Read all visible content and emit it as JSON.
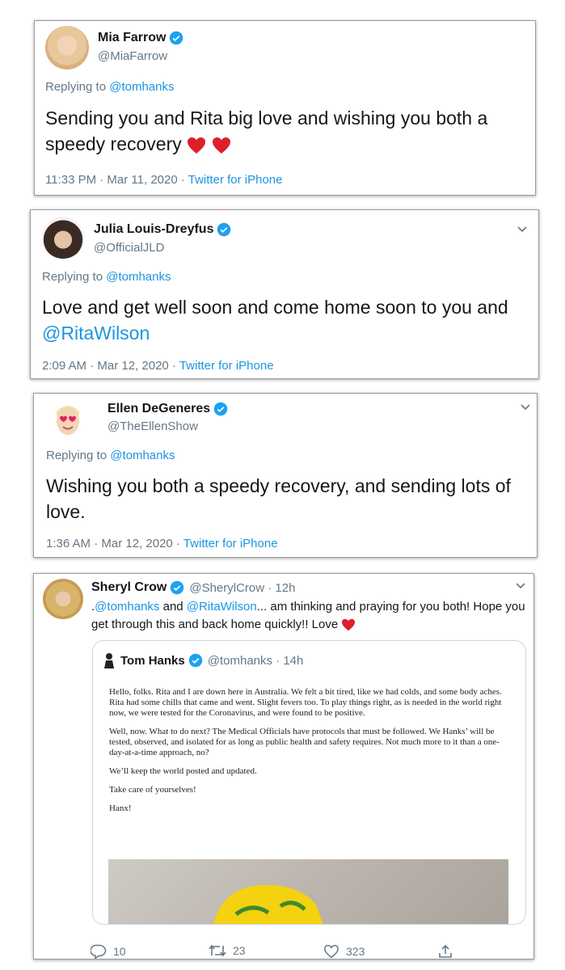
{
  "tweets": [
    {
      "name": "Mia Farrow",
      "handle": "@MiaFarrow",
      "replying_prefix": "Replying to ",
      "replying_to": "@tomhanks",
      "text": "Sending you and Rita big love and wishing you both a speedy recovery",
      "time": "11:33 PM · Mar 11, 2020 · ",
      "source": "Twitter for iPhone"
    },
    {
      "name": "Julia Louis-Dreyfus",
      "handle": "@OfficialJLD",
      "replying_prefix": "Replying to ",
      "replying_to": "@tomhanks",
      "text": "Love and get well soon and come home soon to you and ",
      "mention": "@RitaWilson",
      "time": "2:09 AM · Mar 12, 2020 · ",
      "source": "Twitter for iPhone"
    },
    {
      "name": "Ellen DeGeneres",
      "handle": "@TheEllenShow",
      "replying_prefix": "Replying to ",
      "replying_to": "@tomhanks",
      "text": "Wishing you both a speedy recovery, and sending lots of love.",
      "time": "1:36 AM · Mar 12, 2020 · ",
      "source": "Twitter for iPhone"
    }
  ],
  "crow": {
    "name": "Sheryl Crow",
    "handle_time": "@SherylCrow · 12h",
    "text_dot": ".",
    "mention1": "@tomhanks",
    "and": " and ",
    "mention2": "@RitaWilson",
    "text": "... am thinking and praying for you both! Hope you get through this and back home quickly!! Love",
    "quote": {
      "name": "Tom Hanks",
      "handle_time": "@tomhanks · 14h",
      "paragraphs": [
        "Hello, folks. Rita and I are down here in Australia. We felt a bit tired, like we had colds, and some body aches. Rita had some chills that came and went. Slight fevers too. To play things right, as is needed in the world right now, we were tested for the Coronavirus, and were found to be positive.",
        "Well, now. What to do next? The Medical Officials have protocols that must be followed. We Hanks’ will be tested, observed, and isolated for as long as public health and safety requires. Not much more to it than a one-day-at-a-time approach, no?",
        "We’ll keep the world posted and updated.",
        "Take care of yourselves!",
        "Hanx!"
      ]
    },
    "replies": "10",
    "retweets": "23",
    "likes": "323"
  },
  "colors": {
    "link": "#1b95e0",
    "verified": "#1da1f2",
    "heart": "#e0245e"
  }
}
